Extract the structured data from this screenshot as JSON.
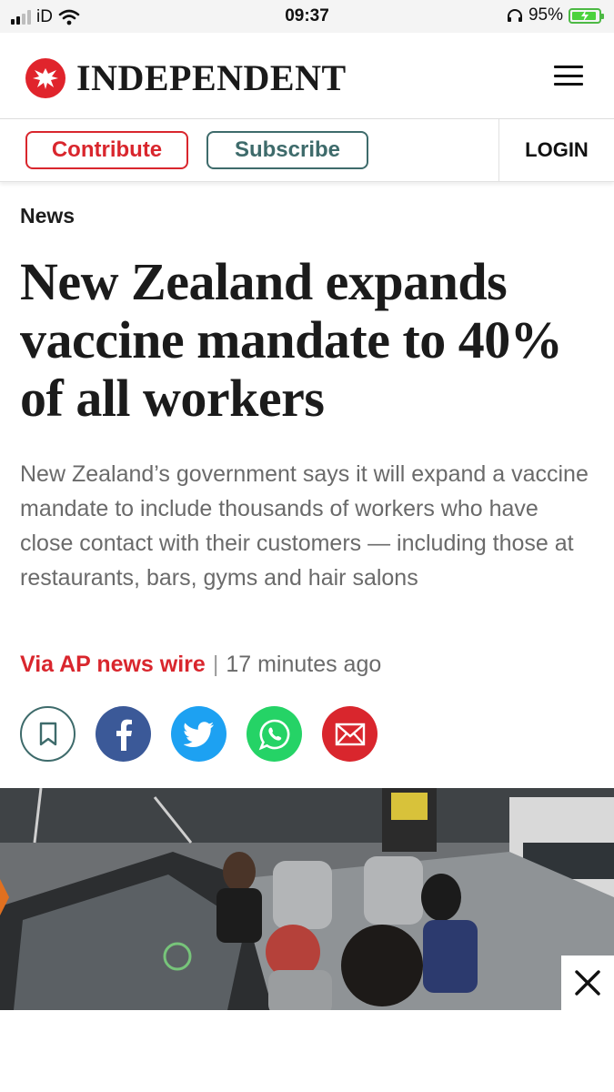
{
  "status_bar": {
    "carrier": "iD",
    "time": "09:37",
    "battery_percent": "95%",
    "signal_bars_active": 2,
    "battery_level": 0.95
  },
  "masthead": {
    "brand": "INDEPENDENT",
    "menu_icon": "hamburger-icon"
  },
  "actions": {
    "contribute_label": "Contribute",
    "subscribe_label": "Subscribe",
    "login_label": "LOGIN"
  },
  "article": {
    "section": "News",
    "headline": "New Zealand expands vaccine mandate to 40% of all workers",
    "standfirst": "New Zealand’s government says it will expand a vaccine mandate to include thousands of workers who have close contact with their customers — including those at restaurants, bars, gyms and hair salons",
    "author": "Via AP news wire",
    "separator": "|",
    "published": "17 minutes ago"
  },
  "share_buttons": [
    {
      "name": "bookmark-icon"
    },
    {
      "name": "facebook-icon"
    },
    {
      "name": "twitter-icon"
    },
    {
      "name": "whatsapp-icon"
    },
    {
      "name": "email-icon"
    }
  ],
  "colors": {
    "brand_red": "#d9262d",
    "subscribe_teal": "#3e6b6b",
    "facebook": "#3b5998",
    "twitter": "#1da1f2",
    "whatsapp": "#25d366",
    "standfirst_gray": "#6a6a6a"
  }
}
